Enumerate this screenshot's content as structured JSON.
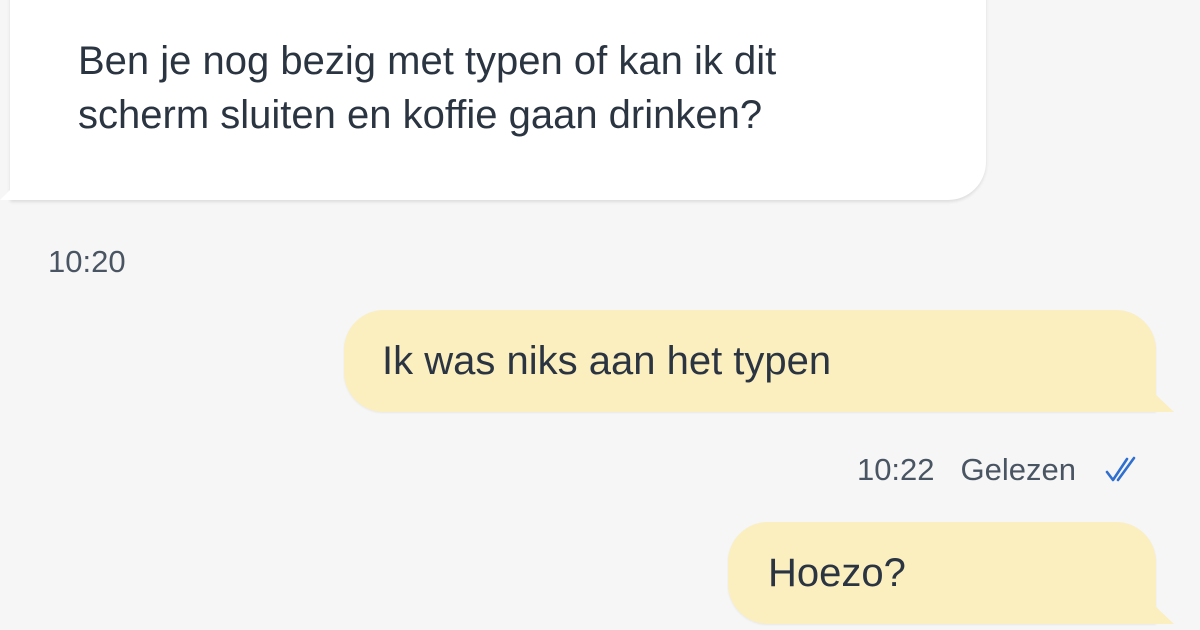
{
  "conversation": {
    "messages": [
      {
        "direction": "incoming",
        "text": "Ben je nog bezig met typen of kan ik dit\nscherm sluiten en koffie gaan drinken?",
        "time": "10:20"
      },
      {
        "direction": "outgoing",
        "text": "Ik was niks aan het typen",
        "time": "10:22",
        "status": "Gelezen",
        "status_icon": "double-check-icon"
      },
      {
        "direction": "outgoing",
        "text": "Hoezo?"
      }
    ]
  },
  "colors": {
    "background": "#f6f6f6",
    "incoming_bubble": "#ffffff",
    "outgoing_bubble": "#fbeebf",
    "text": "#2b3542",
    "meta_text": "#4a5563",
    "read_check": "#2f6fd0"
  }
}
